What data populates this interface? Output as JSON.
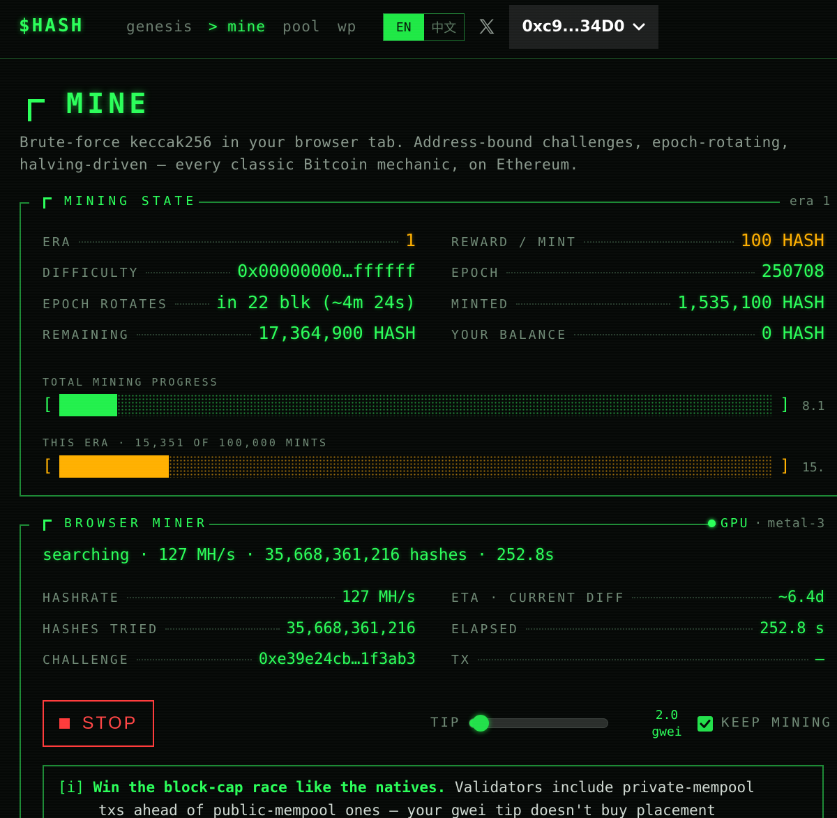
{
  "nav": {
    "logo": "$HASH",
    "items": [
      {
        "label": "genesis"
      },
      {
        "label": "> mine"
      },
      {
        "label": "pool"
      },
      {
        "label": "wp"
      }
    ],
    "lang_en": "EN",
    "lang_zh": "中文",
    "wallet": "0xc9...34D0"
  },
  "header": {
    "title": "MINE",
    "desc_line1": "Brute-force keccak256 in your browser tab. Address-bound challenges, epoch-rotating,",
    "desc_line2": "halving-driven — every classic Bitcoin mechanic, on Ethereum."
  },
  "mining_state": {
    "title": "MINING STATE",
    "tag": "era 1",
    "left": [
      {
        "label": "ERA",
        "value": "1",
        "amber": true
      },
      {
        "label": "DIFFICULTY",
        "value": "0x00000000…ffffff"
      },
      {
        "label": "EPOCH ROTATES",
        "value": "in 22 blk (~4m 24s)"
      },
      {
        "label": "REMAINING",
        "value": "17,364,900 HASH"
      }
    ],
    "right": [
      {
        "label": "REWARD / MINT",
        "value": "100 HASH",
        "amber": true
      },
      {
        "label": "EPOCH",
        "value": "250708"
      },
      {
        "label": "MINTED",
        "value": "1,535,100 HASH"
      },
      {
        "label": "YOUR BALANCE",
        "value": "0 HASH"
      }
    ],
    "total_progress_label": "TOTAL MINING PROGRESS",
    "total_progress_pct": 8.1,
    "total_progress_text": "8.1",
    "era_progress_label": "THIS ERA · 15,351 OF 100,000 MINTS",
    "era_progress_pct": 15.351,
    "era_progress_text": "15.",
    "bracket_open": "[",
    "bracket_close": "]"
  },
  "miner": {
    "title": "BROWSER MINER",
    "gpu_label": "GPU",
    "gpu_sep": "·",
    "gpu_backend": "metal-3",
    "status": "searching · 127 MH/s · 35,668,361,216 hashes · 252.8s",
    "left": [
      {
        "label": "HASHRATE",
        "value": "127 MH/s"
      },
      {
        "label": "HASHES TRIED",
        "value": "35,668,361,216"
      },
      {
        "label": "CHALLENGE",
        "value": "0xe39e24cb…1f3ab3"
      }
    ],
    "right": [
      {
        "label": "ETA · CURRENT DIFF",
        "value": "~6.4d"
      },
      {
        "label": "ELAPSED",
        "value": "252.8 s"
      },
      {
        "label": "TX",
        "value": "—"
      }
    ],
    "stop_label": "STOP",
    "tip_label": "TIP",
    "tip_value": "2.0",
    "tip_unit": "gwei",
    "keep_label": "KEEP MINING",
    "keep_checked": true
  },
  "info": {
    "tag": "[i]",
    "bold": "Win the block-cap race like the natives.",
    "text1": " Validators include private-mempool",
    "text2": "txs ahead of public-mempool ones — your gwei tip doesn't buy placement"
  },
  "colors": {
    "green": "#2bff5a",
    "amber": "#ffb000",
    "red": "#ff3b3b"
  }
}
